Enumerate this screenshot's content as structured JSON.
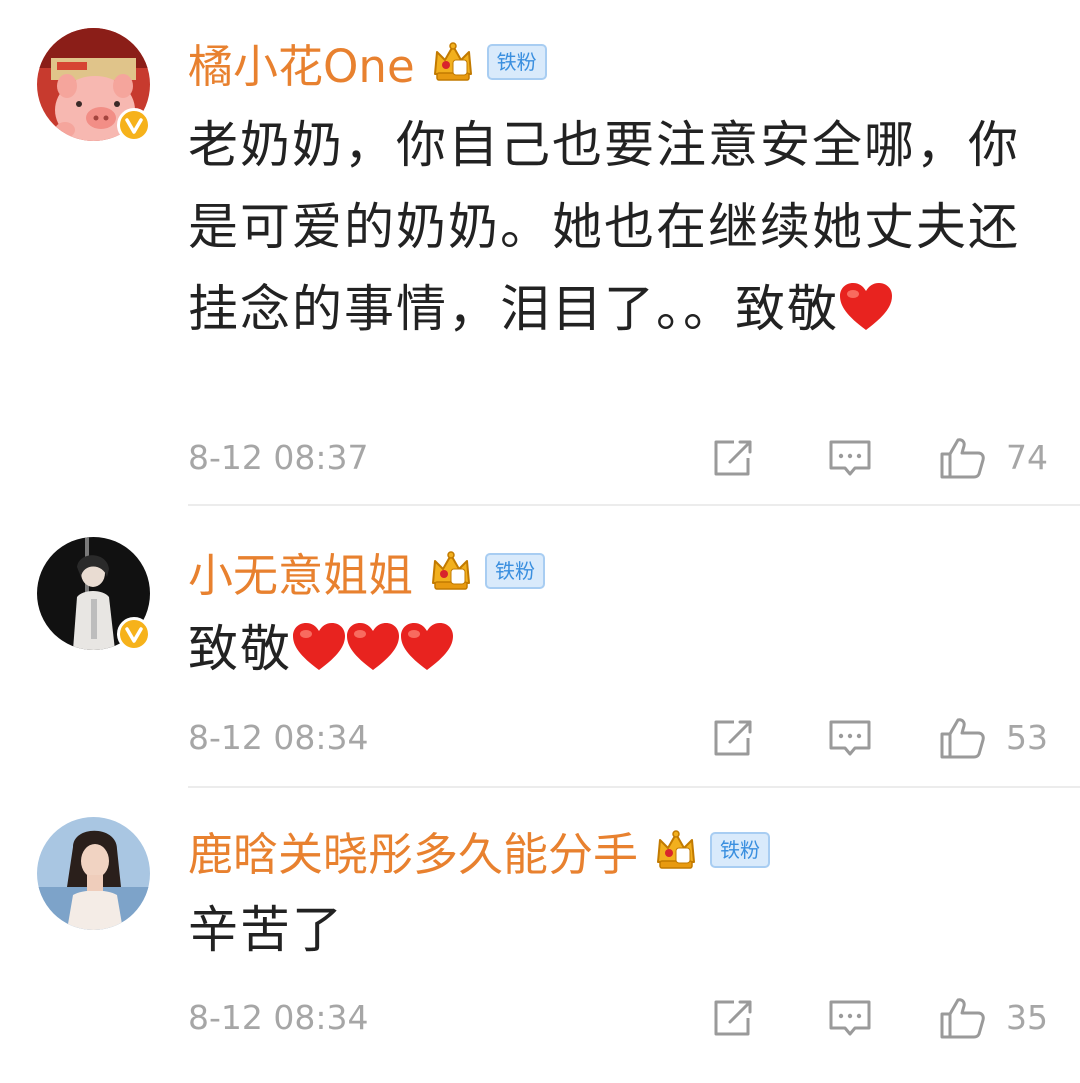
{
  "comments": [
    {
      "username": "橘小花One",
      "fan_badge": "铁粉",
      "crown_level": "4",
      "content": "老奶奶，你自己也要注意安全哪，你是可爱的奶奶。她也在继续她丈夫还挂念的事情，泪目了。。致敬",
      "hearts": 1,
      "time": "8-12 08:37",
      "likes": "74",
      "verified": true
    },
    {
      "username": "小无意姐姐",
      "fan_badge": "铁粉",
      "crown_level": "2",
      "content": "致敬",
      "hearts": 3,
      "time": "8-12 08:34",
      "likes": "53",
      "verified": true
    },
    {
      "username": "鹿晗关晓彤多久能分手",
      "fan_badge": "铁粉",
      "crown_level": "5",
      "content": "辛苦了",
      "hearts": 0,
      "time": "8-12 08:34",
      "likes": "35",
      "verified": false
    }
  ],
  "icons": {
    "share": "share-icon",
    "comment": "comment-icon",
    "like": "thumbs-up-icon",
    "heart": "red-heart-emoji",
    "crown": "crown-icon",
    "verified": "verified-badge-icon"
  },
  "colors": {
    "username": "#e8812f",
    "content": "#222222",
    "meta": "#a6a6a6",
    "badge_bg": "#d9eafb",
    "badge_text": "#3a8fdf",
    "crown": "#f2b01e",
    "heart": "#e8231f"
  }
}
